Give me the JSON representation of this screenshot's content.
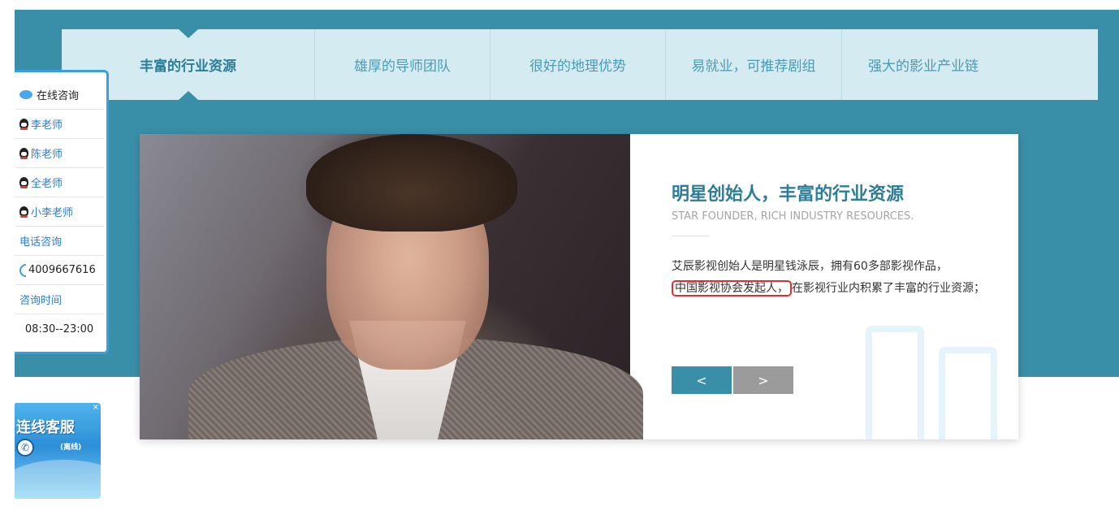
{
  "tabs": [
    {
      "label": "丰富的行业资源",
      "active": true
    },
    {
      "label": "雄厚的导师团队",
      "active": false
    },
    {
      "label": "很好的地理优势",
      "active": false
    },
    {
      "label": "易就业，可推荐剧组",
      "active": false
    },
    {
      "label": "强大的影业产业链",
      "active": false
    }
  ],
  "slide": {
    "title": "明星创始人，丰富的行业资源",
    "subtitle": "STAR FOUNDER, RICH INDUSTRY RESOURCES.",
    "desc_part1": "艾辰影视创始人是明星钱泳辰，拥有60多部影视作品，",
    "desc_highlight": "中国影视协会发起人，",
    "desc_part2": "在影视行业内积累了丰富的行业资源；",
    "prev": "<",
    "next": ">"
  },
  "consult": {
    "title": "在线咨询",
    "teachers": [
      "李老师",
      "陈老师",
      "全老师",
      "小李老师"
    ],
    "phone_label": "电话咨询",
    "phone": "4009667616",
    "hours_label": "咨询时间",
    "hours": "08:30--23:00"
  },
  "service": {
    "title": "连线客服",
    "status": "(离线)",
    "close": "×"
  },
  "colors": {
    "teal": "#3a8fa8",
    "tab_bg": "#d4ecf1",
    "highlight": "#e02f2f"
  }
}
